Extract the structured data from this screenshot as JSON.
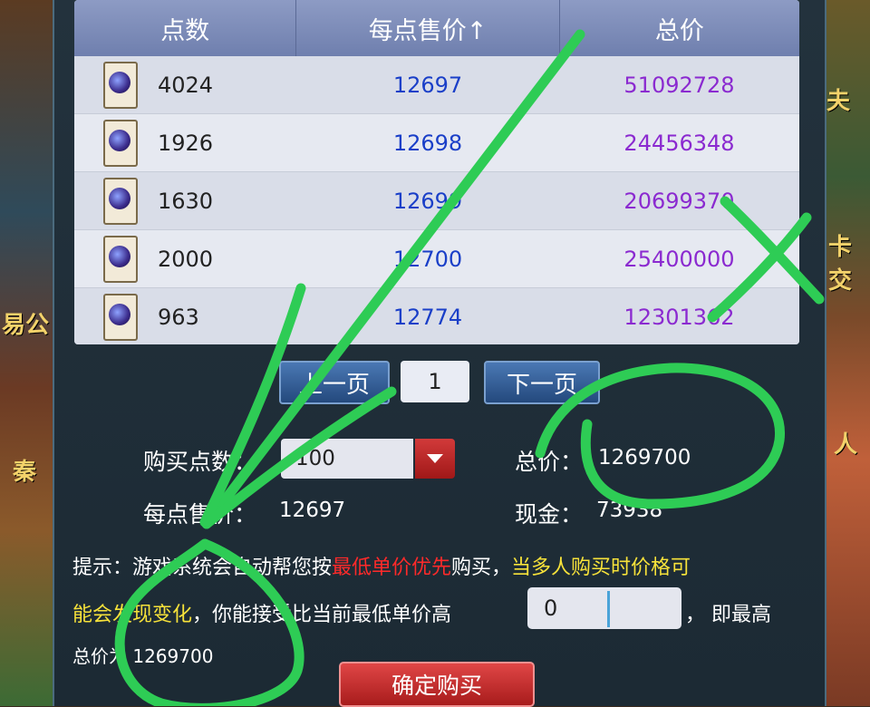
{
  "side_left": [
    "易公",
    "秦"
  ],
  "side_right": [
    "夫",
    "卡交",
    "人"
  ],
  "table": {
    "headers": {
      "points": "点数",
      "unit_price": "每点售价↑",
      "total": "总价"
    },
    "rows": [
      {
        "points": "4024",
        "unit_price": "12697",
        "total": "51092728"
      },
      {
        "points": "1926",
        "unit_price": "12698",
        "total": "24456348"
      },
      {
        "points": "1630",
        "unit_price": "12699",
        "total": "20699370"
      },
      {
        "points": "2000",
        "unit_price": "12700",
        "total": "25400000"
      },
      {
        "points": "963",
        "unit_price": "12774",
        "total": "12301362"
      }
    ]
  },
  "pager": {
    "prev": "上一页",
    "page": "1",
    "next": "下一页"
  },
  "purchase": {
    "qty_label": "购买点数：",
    "qty_value": "100",
    "total_label": "总价：",
    "total_value": "1269700",
    "unit_label": "每点售价：",
    "unit_value": "12697",
    "cash_label": "现金：",
    "cash_value": "73938"
  },
  "tip": {
    "prefix": "提示：游戏系统会自动帮您按",
    "red": "最低单价优先",
    "mid": "购买，",
    "yellow1": "当多人购买时价格可",
    "yellow2": "能会发现变化",
    "line2": "，你能接受比当前最低单价高",
    "premium_value": "0",
    "suffix": "，  即最高",
    "line3": "总价为 1269700"
  },
  "confirm_label": "确定购买",
  "colors": {
    "annotation": "#2ecc55",
    "price_blue": "#1a3fc8",
    "total_purple": "#8b2ad0"
  }
}
